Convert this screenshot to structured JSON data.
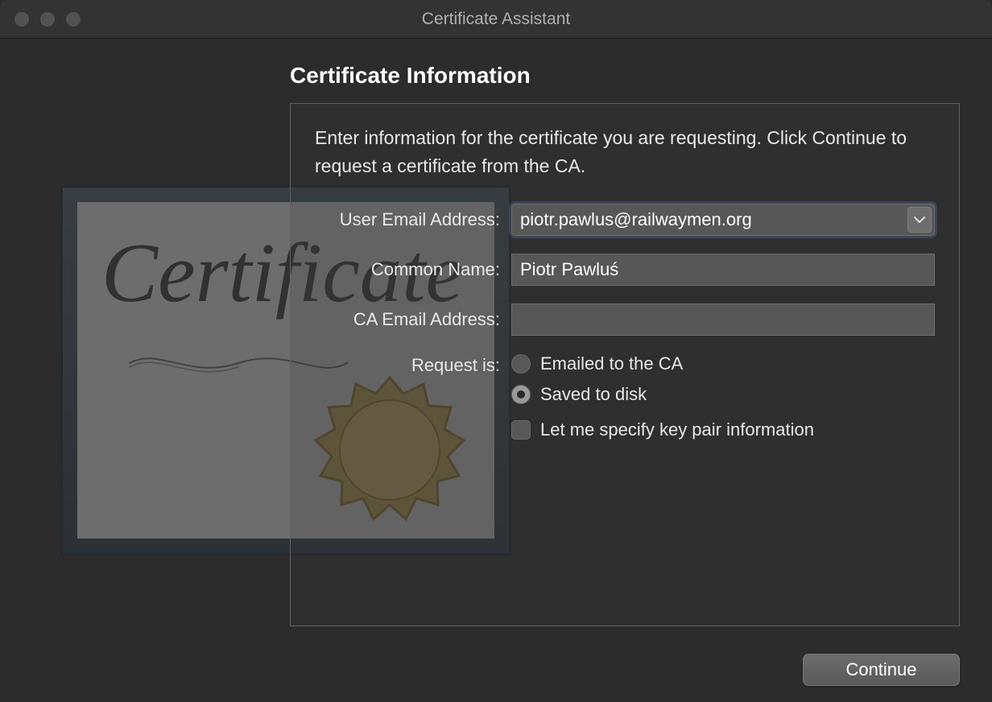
{
  "window": {
    "title": "Certificate Assistant"
  },
  "heading": "Certificate Information",
  "instruction": "Enter information for the certificate you are requesting. Click Continue to request a certificate from the CA.",
  "form": {
    "user_email_label": "User Email Address:",
    "user_email_value": "piotr.pawlus@railwaymen.org",
    "common_name_label": "Common Name:",
    "common_name_value": "Piotr Pawluś",
    "ca_email_label": "CA Email Address:",
    "ca_email_value": "",
    "request_is_label": "Request is:",
    "radio_emailed": "Emailed to the CA",
    "radio_saved": "Saved to disk",
    "radio_selected": "saved",
    "checkbox_specify": "Let me specify key pair information",
    "checkbox_specify_checked": false
  },
  "footer": {
    "continue_label": "Continue"
  },
  "cert_art": {
    "script_text": "Certificate"
  }
}
